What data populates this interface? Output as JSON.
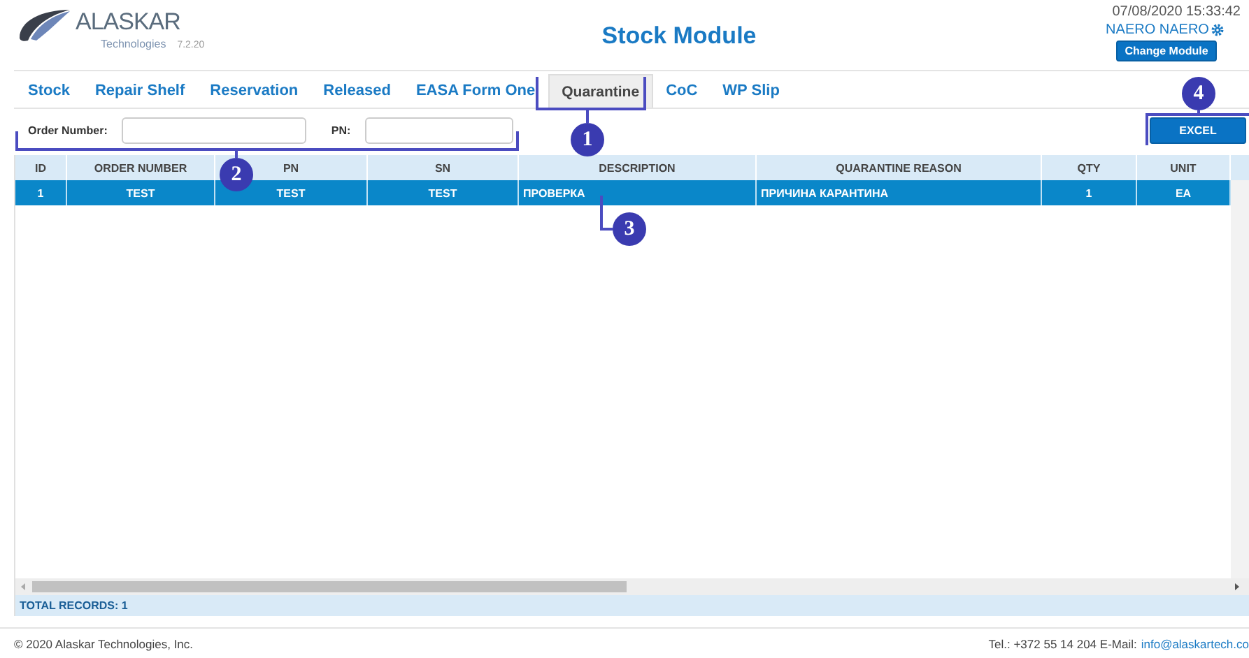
{
  "header": {
    "logo_name": "ALASKAR",
    "logo_sub": "Technologies",
    "version": "7.2.20",
    "title": "Stock Module",
    "datetime": "07/08/2020 15:33:42",
    "user": "NAERO NAERO",
    "change_module": "Change Module"
  },
  "tabs": [
    {
      "label": "Stock",
      "selected": false
    },
    {
      "label": "Repair Shelf",
      "selected": false
    },
    {
      "label": "Reservation",
      "selected": false
    },
    {
      "label": "Released",
      "selected": false
    },
    {
      "label": "EASA Form One",
      "selected": false
    },
    {
      "label": "Quarantine",
      "selected": true
    },
    {
      "label": "CoC",
      "selected": false
    },
    {
      "label": "WP Slip",
      "selected": false
    }
  ],
  "filters": [
    {
      "label": "Order Number:"
    },
    {
      "label": "PN:"
    }
  ],
  "excel_button": "EXCEL",
  "table": {
    "columns": [
      "ID",
      "ORDER NUMBER",
      "PN",
      "SN",
      "DESCRIPTION",
      "QUARANTINE REASON",
      "QTY",
      "UNIT"
    ],
    "rows": [
      {
        "cells": [
          "1",
          "TEST",
          "TEST",
          "TEST",
          "ПРОВЕРКА",
          "ПРИЧИНА КАРАНТИНА",
          "1",
          "EA"
        ],
        "selected": true
      }
    ],
    "total": "TOTAL RECORDS: 1"
  },
  "callouts": [
    "1",
    "2",
    "3",
    "4"
  ],
  "footer": {
    "copyright": "© 2020 Alaskar Technologies, Inc.",
    "contact": "Tel.: +372 55 14 204 E-Mail:",
    "email": "info@alaskartech.co"
  }
}
